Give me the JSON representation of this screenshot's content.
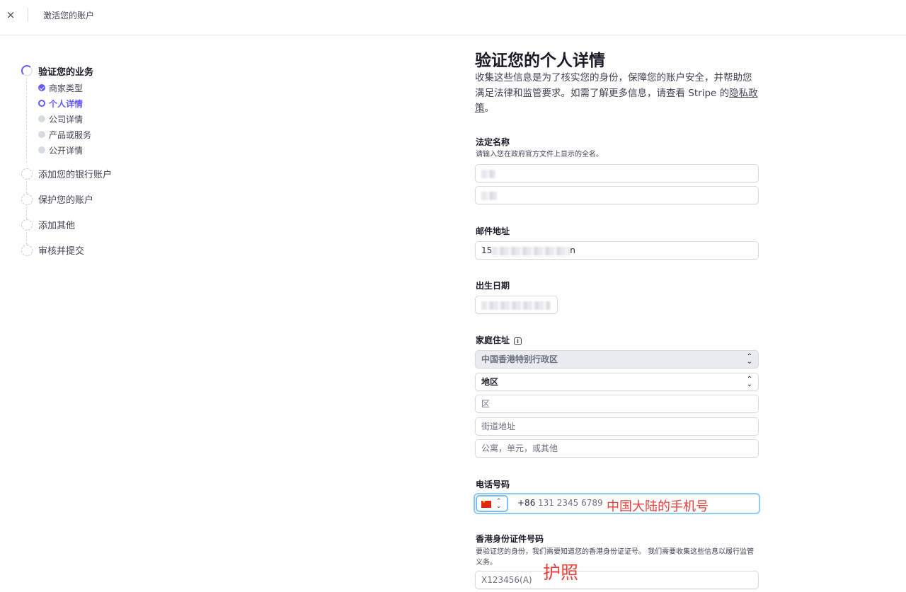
{
  "topbar": {
    "close_icon": "×",
    "title": "激活您的账户"
  },
  "stepper": {
    "steps": [
      {
        "label": "验证您的业务",
        "state": "active"
      },
      {
        "label": "添加您的银行账户",
        "state": "pending"
      },
      {
        "label": "保护您的账户",
        "state": "pending"
      },
      {
        "label": "添加其他",
        "state": "pending"
      },
      {
        "label": "审核并提交",
        "state": "pending"
      }
    ],
    "substeps": [
      {
        "label": "商家类型",
        "state": "done"
      },
      {
        "label": "个人详情",
        "state": "current"
      },
      {
        "label": "公司详情",
        "state": "todo"
      },
      {
        "label": "产品或服务",
        "state": "todo"
      },
      {
        "label": "公开详情",
        "state": "todo"
      }
    ]
  },
  "form": {
    "title": "验证您的个人详情",
    "intro_text": "收集这些信息是为了核实您的身份，保障您的账户安全，并帮助您满足法律和监管要求。如需了解更多信息，请查看 Stripe 的",
    "intro_link": "隐私政策",
    "intro_end": "。",
    "legal_name": {
      "label": "法定名称",
      "help": "请输入您在政府官方文件上显示的全名。"
    },
    "email": {
      "label": "邮件地址",
      "value_prefix": "15",
      "value_suffix": "n"
    },
    "dob": {
      "label": "出生日期"
    },
    "home_address": {
      "label": "家庭住址",
      "info_icon": "i",
      "country": "中国香港特别行政区",
      "region": "地区",
      "district_placeholder": "区",
      "street_placeholder": "街道地址",
      "apartment_placeholder": "公寓，单元，或其他"
    },
    "phone": {
      "label": "电话号码",
      "country_code": "+86",
      "placeholder": "131 2345 6789"
    },
    "hkid": {
      "label": "香港身份证件号码",
      "help": "要验证您的身份，我们需要知道您的香港身份证证号。 我们需要收集这些信息以履行监管义务。",
      "placeholder": "X123456(A)"
    }
  },
  "annotations": {
    "phone_note": "中国大陆的手机号",
    "passport_note": "护照",
    "color": "#e8413c"
  },
  "colors": {
    "accent": "#635bff",
    "focus": "#8ecbf2"
  }
}
